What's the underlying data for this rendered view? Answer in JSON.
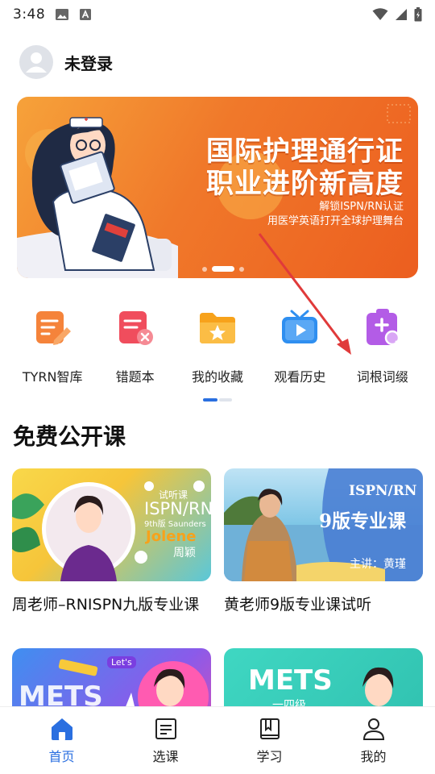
{
  "status_bar": {
    "time": "3:48"
  },
  "profile": {
    "name": "未登录"
  },
  "banner": {
    "title_line1": "国际护理通行证",
    "title_line2": "职业进阶新高度",
    "subtitle_line1": "解锁ISPN/RN认证",
    "subtitle_line2": "用医学英语打开全球护理舞台",
    "total_slides": 3,
    "active_slide": 2
  },
  "quick_menu": [
    {
      "label": "TYRN智库",
      "icon": "notes-edit-icon",
      "color": "#f5833a"
    },
    {
      "label": "错题本",
      "icon": "wrong-answers-icon",
      "color": "#f04d5d"
    },
    {
      "label": "我的收藏",
      "icon": "favorites-folder-icon",
      "color": "#f7a21b"
    },
    {
      "label": "观看历史",
      "icon": "tv-history-icon",
      "color": "#2f8ff0"
    },
    {
      "label": "词根词缀",
      "icon": "word-roots-icon",
      "color": "#b35ce6"
    }
  ],
  "section": {
    "title": "免费公开课"
  },
  "courses": [
    {
      "title": "周老师–RNISPN九版专业课",
      "thumb": {
        "tag": "试听课",
        "line1": "ISPN/RN",
        "line2": "9th版 Saunders",
        "name_en": "Jolene",
        "name_cn": "周颖"
      }
    },
    {
      "title": "黄老师9版专业课试听",
      "thumb": {
        "line1": "ISPN/RN",
        "line2": "9版专业课",
        "lecturer": "主讲：黄瑾"
      }
    },
    {
      "title": "",
      "thumb": {
        "line1": "METS",
        "badge": "Let's"
      }
    },
    {
      "title": "",
      "thumb": {
        "line1": "METS",
        "line2": "一四级"
      }
    }
  ],
  "bottom_nav": [
    {
      "label": "首页",
      "icon": "home-icon",
      "active": true
    },
    {
      "label": "选课",
      "icon": "course-list-icon",
      "active": false
    },
    {
      "label": "学习",
      "icon": "book-icon",
      "active": false
    },
    {
      "label": "我的",
      "icon": "profile-icon",
      "active": false
    }
  ],
  "colors": {
    "accent": "#2a6fe0",
    "banner_orange": "#f0782a",
    "arrow_red": "#e03a3a"
  }
}
